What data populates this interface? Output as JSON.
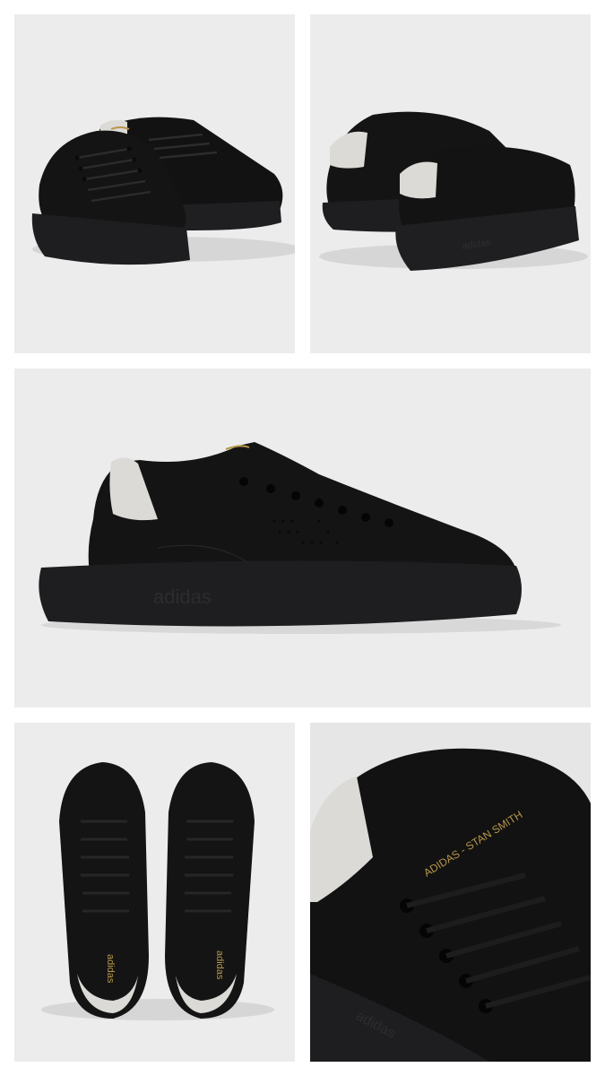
{
  "gallery": {
    "background": "#ececec",
    "panels": [
      {
        "id": "front-pair-view"
      },
      {
        "id": "rear-pair-view"
      },
      {
        "id": "side-profile-view"
      },
      {
        "id": "top-down-pair-view"
      },
      {
        "id": "heel-closeup-view"
      }
    ]
  },
  "product": {
    "upper_color": "#131313",
    "sole_color": "#1e1e20",
    "heel_tab_color": "#dcdad6",
    "branding_color": "#b8964a",
    "sole_embossed_text": "adidas",
    "tongue_text": "adidas",
    "heel_text": "ADIDAS - STAN SMITH"
  }
}
